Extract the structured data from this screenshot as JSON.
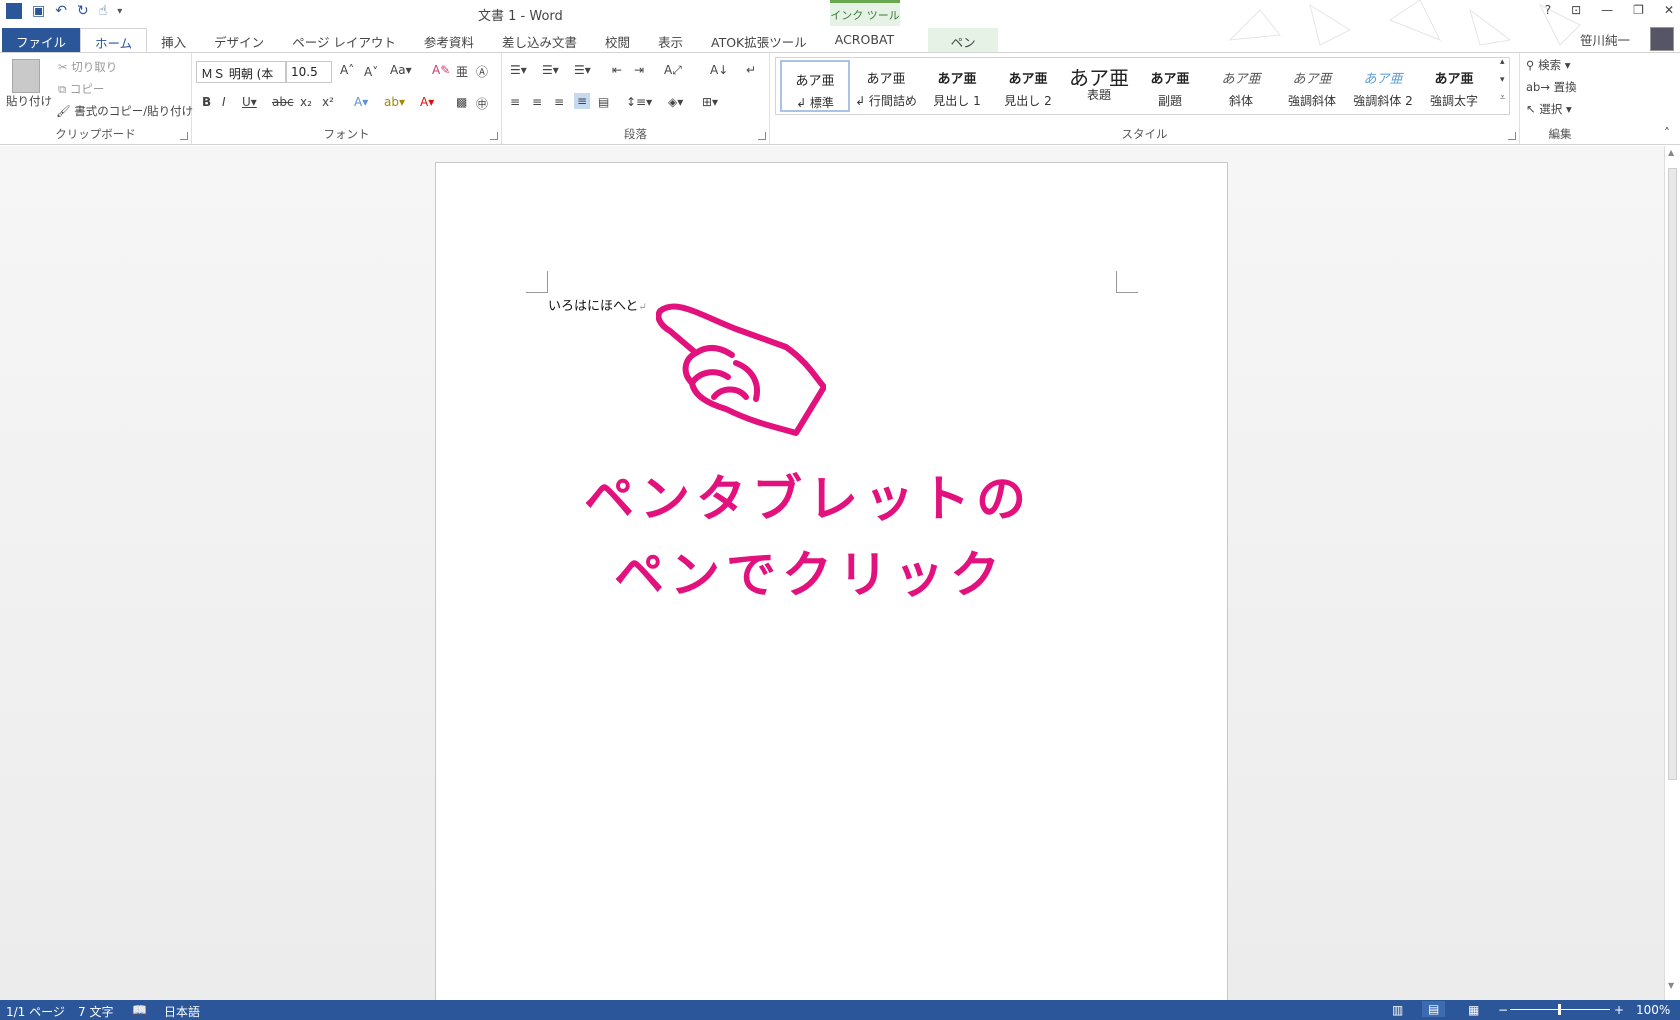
{
  "window": {
    "title": "文書 1 - Word",
    "ink_tools_header": "インク ツール",
    "help": "?",
    "user": "笹川純一"
  },
  "tabs": {
    "file": "ファイル",
    "home": "ホーム",
    "insert": "挿入",
    "design": "デザイン",
    "page_layout": "ページ レイアウト",
    "references": "参考資料",
    "mailings": "差し込み文書",
    "review": "校閲",
    "view": "表示",
    "atok": "ATOK拡張ツール",
    "acrobat": "ACROBAT",
    "pen": "ペン"
  },
  "ribbon": {
    "clipboard": {
      "label": "クリップボード",
      "paste": "貼り付け",
      "cut": "切り取り",
      "copy": "コピー",
      "format_painter": "書式のコピー/貼り付け"
    },
    "font": {
      "label": "フォント",
      "font_name": "ＭＳ 明朝 (本",
      "font_size": "10.5"
    },
    "paragraph": {
      "label": "段落"
    },
    "styles": {
      "label": "スタイル",
      "items": [
        {
          "preview": "あア亜",
          "name": "↲ 標準"
        },
        {
          "preview": "あア亜",
          "name": "↲ 行間詰め"
        },
        {
          "preview": "あア亜",
          "name": "見出し 1"
        },
        {
          "preview": "あア亜",
          "name": "見出し 2"
        },
        {
          "preview": "あア亜",
          "name": "表題"
        },
        {
          "preview": "あア亜",
          "name": "副題"
        },
        {
          "preview": "あア亜",
          "name": "斜体"
        },
        {
          "preview": "あア亜",
          "name": "強調斜体"
        },
        {
          "preview": "あア亜",
          "name": "強調斜体 2"
        },
        {
          "preview": "あア亜",
          "name": "強調太字"
        }
      ]
    },
    "editing": {
      "label": "編集",
      "find": "検索",
      "replace": "置換",
      "select": "選択"
    }
  },
  "document": {
    "text": "いろはにほへと",
    "callout_line1": "ペンタブレットの",
    "callout_line2": "ペンでクリック"
  },
  "status": {
    "page": "1/1 ページ",
    "words": "7 文字",
    "language": "日本語",
    "zoom": "100%"
  },
  "colors": {
    "accent": "#2b579a",
    "callout": "#e3117d",
    "ink_tab": "#e6f2e6"
  }
}
